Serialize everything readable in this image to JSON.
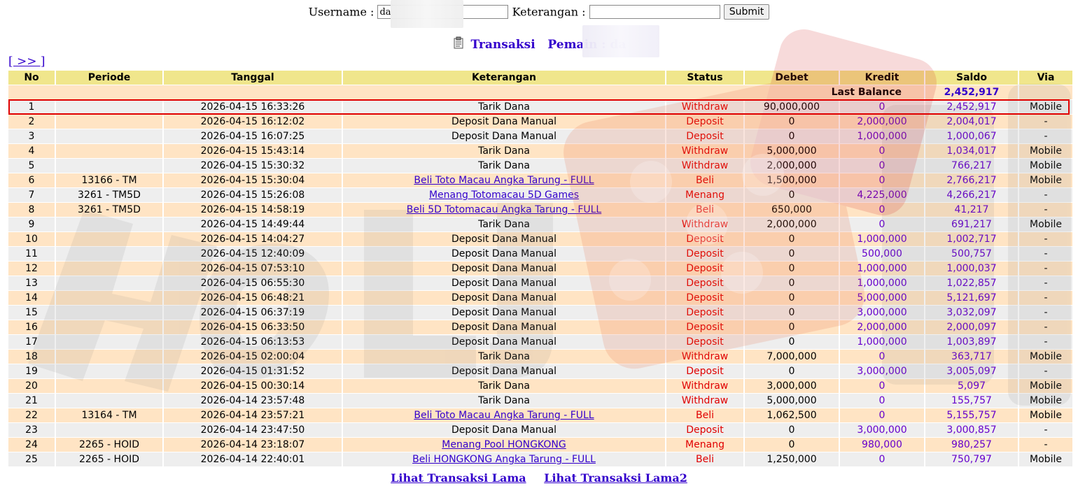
{
  "form": {
    "username_label": "Username :",
    "username_value": "da",
    "keterangan_label": "Keterangan :",
    "keterangan_value": "",
    "submit_label": "Submit"
  },
  "heading": {
    "transaksi": "Transaksi",
    "pemain": "Pemain : da"
  },
  "next_link": "[ >> ]",
  "table": {
    "headers": [
      "No",
      "Periode",
      "Tanggal",
      "Keterangan",
      "Status",
      "Debet",
      "Kredit",
      "Saldo",
      "Via"
    ],
    "last_balance_label": "Last Balance",
    "last_balance_value": "2,452,917",
    "rows": [
      {
        "no": "1",
        "periode": "",
        "tanggal": "2026-04-15 16:33:26",
        "keterangan": "Tarik Dana",
        "link": false,
        "status": "Withdraw",
        "debet": "90,000,000",
        "kredit": "0",
        "saldo": "2,452,917",
        "via": "Mobile"
      },
      {
        "no": "2",
        "periode": "",
        "tanggal": "2026-04-15 16:12:02",
        "keterangan": "Deposit Dana Manual",
        "link": false,
        "status": "Deposit",
        "debet": "0",
        "kredit": "2,000,000",
        "saldo": "2,004,017",
        "via": "-"
      },
      {
        "no": "3",
        "periode": "",
        "tanggal": "2026-04-15 16:07:25",
        "keterangan": "Deposit Dana Manual",
        "link": false,
        "status": "Deposit",
        "debet": "0",
        "kredit": "1,000,000",
        "saldo": "1,000,067",
        "via": "-"
      },
      {
        "no": "4",
        "periode": "",
        "tanggal": "2026-04-15 15:43:14",
        "keterangan": "Tarik Dana",
        "link": false,
        "status": "Withdraw",
        "debet": "5,000,000",
        "kredit": "0",
        "saldo": "1,034,017",
        "via": "Mobile"
      },
      {
        "no": "5",
        "periode": "",
        "tanggal": "2026-04-15 15:30:32",
        "keterangan": "Tarik Dana",
        "link": false,
        "status": "Withdraw",
        "debet": "2,000,000",
        "kredit": "0",
        "saldo": "766,217",
        "via": "Mobile"
      },
      {
        "no": "6",
        "periode": "13166 - TM",
        "tanggal": "2026-04-15 15:30:04",
        "keterangan": "Beli Toto Macau Angka Tarung - FULL",
        "link": true,
        "status": "Beli",
        "debet": "1,500,000",
        "kredit": "0",
        "saldo": "2,766,217",
        "via": "Mobile"
      },
      {
        "no": "7",
        "periode": "3261 - TM5D",
        "tanggal": "2026-04-15 15:26:08",
        "keterangan": "Menang Totomacau 5D Games",
        "link": true,
        "status": "Menang",
        "debet": "0",
        "kredit": "4,225,000",
        "saldo": "4,266,217",
        "via": "-"
      },
      {
        "no": "8",
        "periode": "3261 - TM5D",
        "tanggal": "2026-04-15 14:58:19",
        "keterangan": "Beli 5D Totomacau Angka Tarung - FULL",
        "link": true,
        "status": "Beli",
        "debet": "650,000",
        "kredit": "0",
        "saldo": "41,217",
        "via": "-"
      },
      {
        "no": "9",
        "periode": "",
        "tanggal": "2026-04-15 14:49:44",
        "keterangan": "Tarik Dana",
        "link": false,
        "status": "Withdraw",
        "debet": "2,000,000",
        "kredit": "0",
        "saldo": "691,217",
        "via": "Mobile"
      },
      {
        "no": "10",
        "periode": "",
        "tanggal": "2026-04-15 14:04:27",
        "keterangan": "Deposit Dana Manual",
        "link": false,
        "status": "Deposit",
        "debet": "0",
        "kredit": "1,000,000",
        "saldo": "1,002,717",
        "via": "-"
      },
      {
        "no": "11",
        "periode": "",
        "tanggal": "2026-04-15 12:40:09",
        "keterangan": "Deposit Dana Manual",
        "link": false,
        "status": "Deposit",
        "debet": "0",
        "kredit": "500,000",
        "saldo": "500,757",
        "via": "-"
      },
      {
        "no": "12",
        "periode": "",
        "tanggal": "2026-04-15 07:53:10",
        "keterangan": "Deposit Dana Manual",
        "link": false,
        "status": "Deposit",
        "debet": "0",
        "kredit": "1,000,000",
        "saldo": "1,000,037",
        "via": "-"
      },
      {
        "no": "13",
        "periode": "",
        "tanggal": "2026-04-15 06:55:30",
        "keterangan": "Deposit Dana Manual",
        "link": false,
        "status": "Deposit",
        "debet": "0",
        "kredit": "1,000,000",
        "saldo": "1,022,857",
        "via": "-"
      },
      {
        "no": "14",
        "periode": "",
        "tanggal": "2026-04-15 06:48:21",
        "keterangan": "Deposit Dana Manual",
        "link": false,
        "status": "Deposit",
        "debet": "0",
        "kredit": "5,000,000",
        "saldo": "5,121,697",
        "via": "-"
      },
      {
        "no": "15",
        "periode": "",
        "tanggal": "2026-04-15 06:37:19",
        "keterangan": "Deposit Dana Manual",
        "link": false,
        "status": "Deposit",
        "debet": "0",
        "kredit": "3,000,000",
        "saldo": "3,032,097",
        "via": "-"
      },
      {
        "no": "16",
        "periode": "",
        "tanggal": "2026-04-15 06:33:50",
        "keterangan": "Deposit Dana Manual",
        "link": false,
        "status": "Deposit",
        "debet": "0",
        "kredit": "2,000,000",
        "saldo": "2,000,097",
        "via": "-"
      },
      {
        "no": "17",
        "periode": "",
        "tanggal": "2026-04-15 06:13:53",
        "keterangan": "Deposit Dana Manual",
        "link": false,
        "status": "Deposit",
        "debet": "0",
        "kredit": "1,000,000",
        "saldo": "1,003,897",
        "via": "-"
      },
      {
        "no": "18",
        "periode": "",
        "tanggal": "2026-04-15 02:00:04",
        "keterangan": "Tarik Dana",
        "link": false,
        "status": "Withdraw",
        "debet": "7,000,000",
        "kredit": "0",
        "saldo": "363,717",
        "via": "Mobile"
      },
      {
        "no": "19",
        "periode": "",
        "tanggal": "2026-04-15 01:31:52",
        "keterangan": "Deposit Dana Manual",
        "link": false,
        "status": "Deposit",
        "debet": "0",
        "kredit": "3,000,000",
        "saldo": "3,005,097",
        "via": "-"
      },
      {
        "no": "20",
        "periode": "",
        "tanggal": "2026-04-15 00:30:14",
        "keterangan": "Tarik Dana",
        "link": false,
        "status": "Withdraw",
        "debet": "3,000,000",
        "kredit": "0",
        "saldo": "5,097",
        "via": "Mobile"
      },
      {
        "no": "21",
        "periode": "",
        "tanggal": "2026-04-14 23:57:48",
        "keterangan": "Tarik Dana",
        "link": false,
        "status": "Withdraw",
        "debet": "5,000,000",
        "kredit": "0",
        "saldo": "155,757",
        "via": "Mobile"
      },
      {
        "no": "22",
        "periode": "13164 - TM",
        "tanggal": "2026-04-14 23:57:21",
        "keterangan": "Beli Toto Macau Angka Tarung - FULL",
        "link": true,
        "status": "Beli",
        "debet": "1,062,500",
        "kredit": "0",
        "saldo": "5,155,757",
        "via": "Mobile"
      },
      {
        "no": "23",
        "periode": "",
        "tanggal": "2026-04-14 23:47:50",
        "keterangan": "Deposit Dana Manual",
        "link": false,
        "status": "Deposit",
        "debet": "0",
        "kredit": "3,000,000",
        "saldo": "3,000,857",
        "via": "-"
      },
      {
        "no": "24",
        "periode": "2265 - HOID",
        "tanggal": "2026-04-14 23:18:07",
        "keterangan": "Menang Pool HONGKONG",
        "link": true,
        "status": "Menang",
        "debet": "0",
        "kredit": "980,000",
        "saldo": "980,257",
        "via": "-"
      },
      {
        "no": "25",
        "periode": "2265 - HOID",
        "tanggal": "2026-04-14 22:40:01",
        "keterangan": "Beli HONGKONG Angka Tarung - FULL",
        "link": true,
        "status": "Beli",
        "debet": "1,250,000",
        "kredit": "0",
        "saldo": "750,797",
        "via": "Mobile"
      }
    ]
  },
  "bottom": {
    "link1": "Lihat Transaksi Lama",
    "link2": "Lihat Transaksi Lama2"
  },
  "colors": {
    "header_bg": "#f0e68c",
    "row_odd_bg": "#ffe4c4",
    "row_even_bg": "#eeeeee",
    "status_red": "#e00000",
    "amount_purple": "#6600cc",
    "link_blue": "#3300cc",
    "highlight_border": "#e00000"
  }
}
